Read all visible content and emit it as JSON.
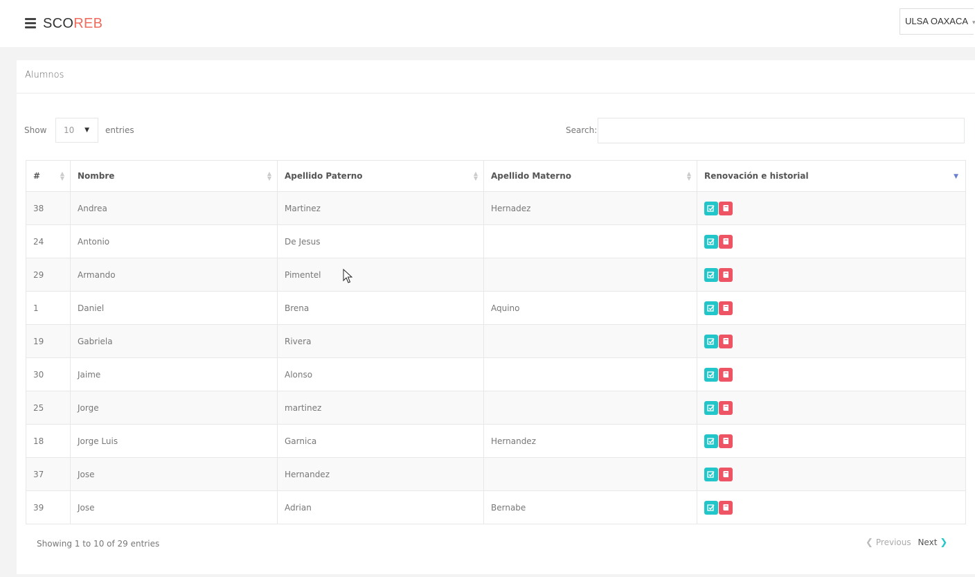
{
  "header": {
    "brand_part1": "SCO",
    "brand_part2": "REB",
    "brand_accent_color": "#ef6b5e",
    "org_name": "ULSA OAXACA",
    "org_caret": "▾"
  },
  "panel": {
    "title": "Alumnos"
  },
  "controls": {
    "show_label": "Show",
    "page_length": "10",
    "entries_label": "entries",
    "search_label": "Search:",
    "search_value": ""
  },
  "table": {
    "columns": [
      "#",
      "Nombre",
      "Apellido Paterno",
      "Apellido Materno",
      "Renovación e historial"
    ],
    "rows": [
      {
        "id": "38",
        "nombre": "Andrea",
        "paterno": "Martinez",
        "materno": "Hernadez"
      },
      {
        "id": "24",
        "nombre": "Antonio",
        "paterno": "De Jesus",
        "materno": ""
      },
      {
        "id": "29",
        "nombre": "Armando",
        "paterno": "Pimentel",
        "materno": ""
      },
      {
        "id": "1",
        "nombre": "Daniel",
        "paterno": "Brena",
        "materno": "Aquino"
      },
      {
        "id": "19",
        "nombre": "Gabriela",
        "paterno": "Rivera",
        "materno": ""
      },
      {
        "id": "30",
        "nombre": "Jaime",
        "paterno": "Alonso",
        "materno": ""
      },
      {
        "id": "25",
        "nombre": "Jorge",
        "paterno": "martinez",
        "materno": ""
      },
      {
        "id": "18",
        "nombre": "Jorge Luis",
        "paterno": "Garnica",
        "materno": "Hernandez"
      },
      {
        "id": "37",
        "nombre": "Jose",
        "paterno": "Hernandez",
        "materno": ""
      },
      {
        "id": "39",
        "nombre": "Jose",
        "paterno": "Adrian",
        "materno": "Bernabe"
      }
    ],
    "action_icons": [
      "edit-check-icon",
      "book-icon"
    ],
    "action_colors": {
      "edit": "#23c6c8",
      "history": "#ed5565"
    }
  },
  "footer": {
    "info": "Showing 1 to 10 of 29 entries",
    "previous": "Previous",
    "next": "Next"
  }
}
